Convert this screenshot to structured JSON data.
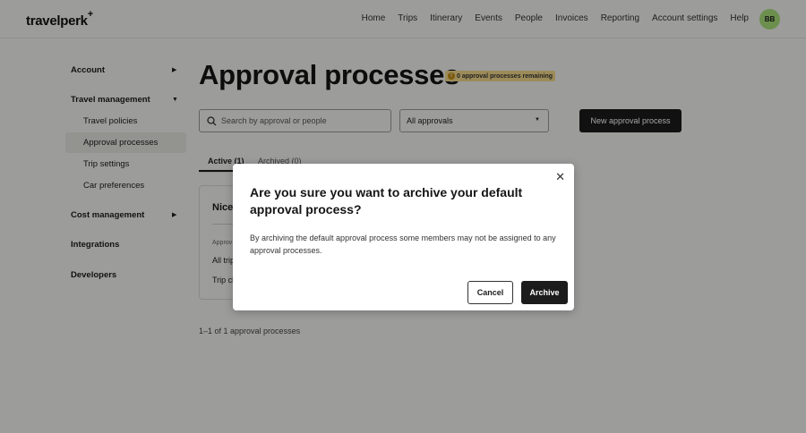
{
  "header": {
    "logo": "travelperk",
    "logo_mark": "+",
    "nav": [
      "Home",
      "Trips",
      "Itinerary",
      "Events",
      "People",
      "Invoices",
      "Reporting",
      "Account settings",
      "Help"
    ],
    "avatar_initials": "BB"
  },
  "sidebar": {
    "account": "Account",
    "travel_management": "Travel management",
    "travel_policies": "Travel policies",
    "approval_processes": "Approval processes",
    "trip_settings": "Trip settings",
    "car_preferences": "Car preferences",
    "cost_management": "Cost management",
    "integrations": "Integrations",
    "developers": "Developers"
  },
  "main": {
    "title": "Approval processes",
    "remaining_badge": "0 approval processes remaining",
    "search_placeholder": "Search by approval or people",
    "filter_value": "All approvals",
    "new_button": "New approval process",
    "tabs": [
      {
        "label": "Active (1)",
        "active": true
      },
      {
        "label": "Archived (0)",
        "active": false
      }
    ],
    "card": {
      "title": "Nice",
      "label": "Approv",
      "row1": "All trip",
      "row2": "Trip cl"
    },
    "count": "1–1 of 1 approval processes"
  },
  "modal": {
    "title": "Are you sure you want to archive your default approval process?",
    "body": "By archiving the default approval process some members may not be assigned to any approval processes.",
    "cancel": "Cancel",
    "archive": "Archive"
  },
  "colors": {
    "accent_dark": "#1c1c1c",
    "avatar": "#a9e07a",
    "badge": "#f5d98a"
  }
}
